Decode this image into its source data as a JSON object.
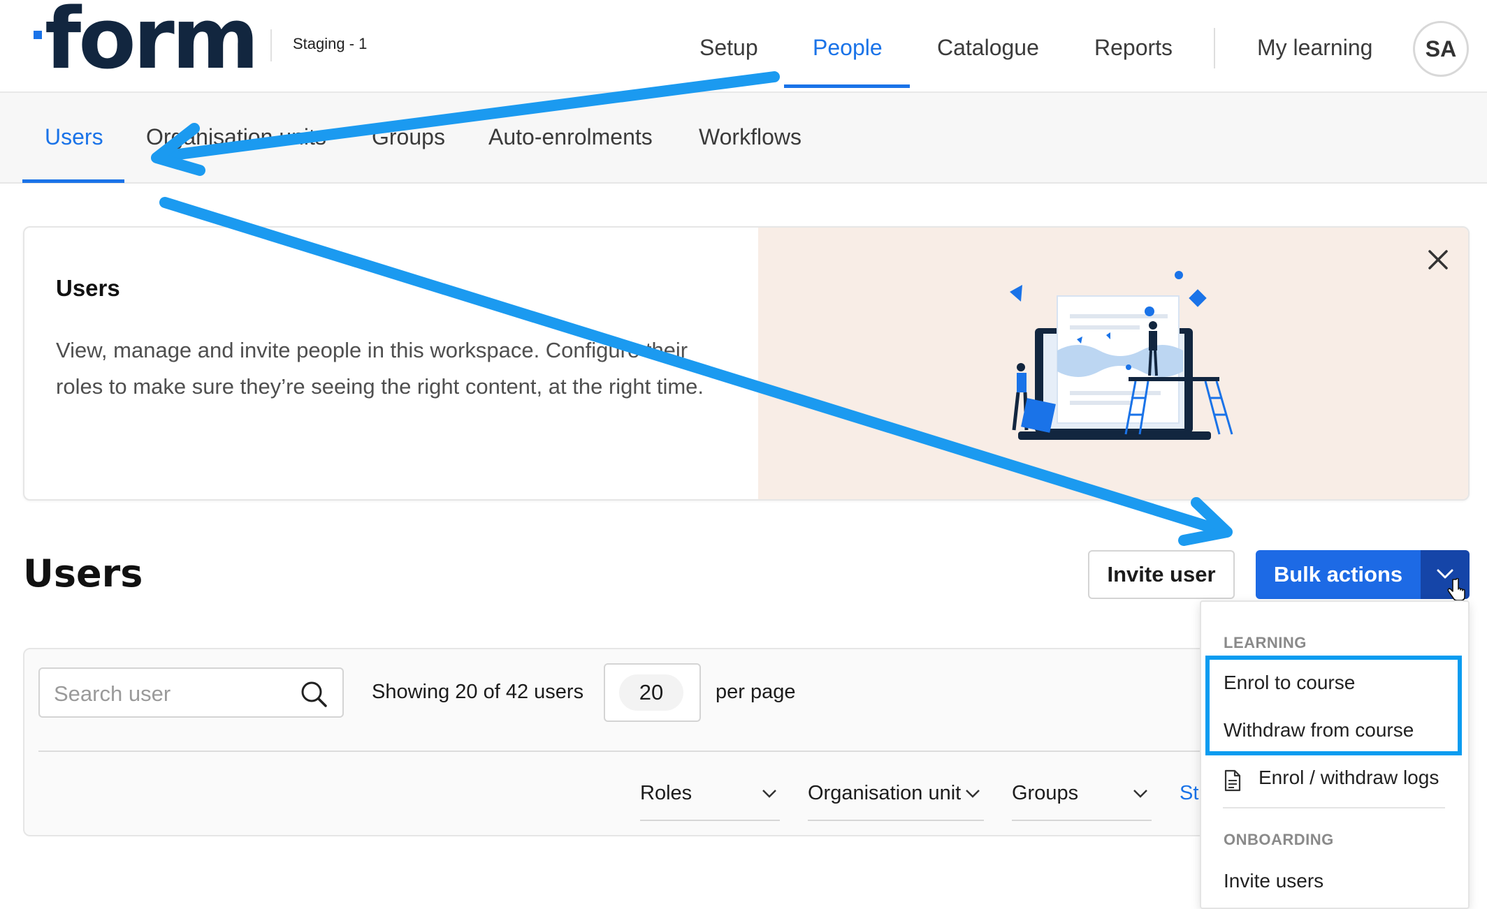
{
  "header": {
    "logo_text": "form",
    "environment": "Staging - 1",
    "nav": [
      "Setup",
      "People",
      "Catalogue",
      "Reports",
      "My learning"
    ],
    "active_nav": "People",
    "avatar_initials": "SA"
  },
  "subnav": {
    "items": [
      "Users",
      "Organisation units",
      "Groups",
      "Auto-enrolments",
      "Workflows"
    ],
    "active": "Users"
  },
  "info_card": {
    "title": "Users",
    "body": "View, manage and invite people in this workspace. Configure their roles to make sure they’re seeing the right content, at the right time."
  },
  "page": {
    "title": "Users",
    "invite_button": "Invite user",
    "bulk_button": "Bulk actions"
  },
  "filters": {
    "search_placeholder": "Search user",
    "showing_text": "Showing 20 of 42 users",
    "per_page_value": "20",
    "per_page_label": "per page",
    "columns": [
      "Roles",
      "Organisation unit",
      "Groups",
      "St"
    ]
  },
  "bulk_menu": {
    "learning_label": "LEARNING",
    "enrol": "Enrol to course",
    "withdraw": "Withdraw from course",
    "logs": "Enrol / withdraw logs",
    "onboarding_label": "ONBOARDING",
    "invite_users": "Invite users"
  },
  "colors": {
    "accent": "#1a73e8",
    "primary_button": "#1d6ae5",
    "annotation": "#1b9af0",
    "logo": "#12263f",
    "art_background": "#f8ede6"
  },
  "icons": [
    "close-icon",
    "search-icon",
    "chevron-down-icon",
    "document-icon",
    "pointer-cursor-icon"
  ]
}
